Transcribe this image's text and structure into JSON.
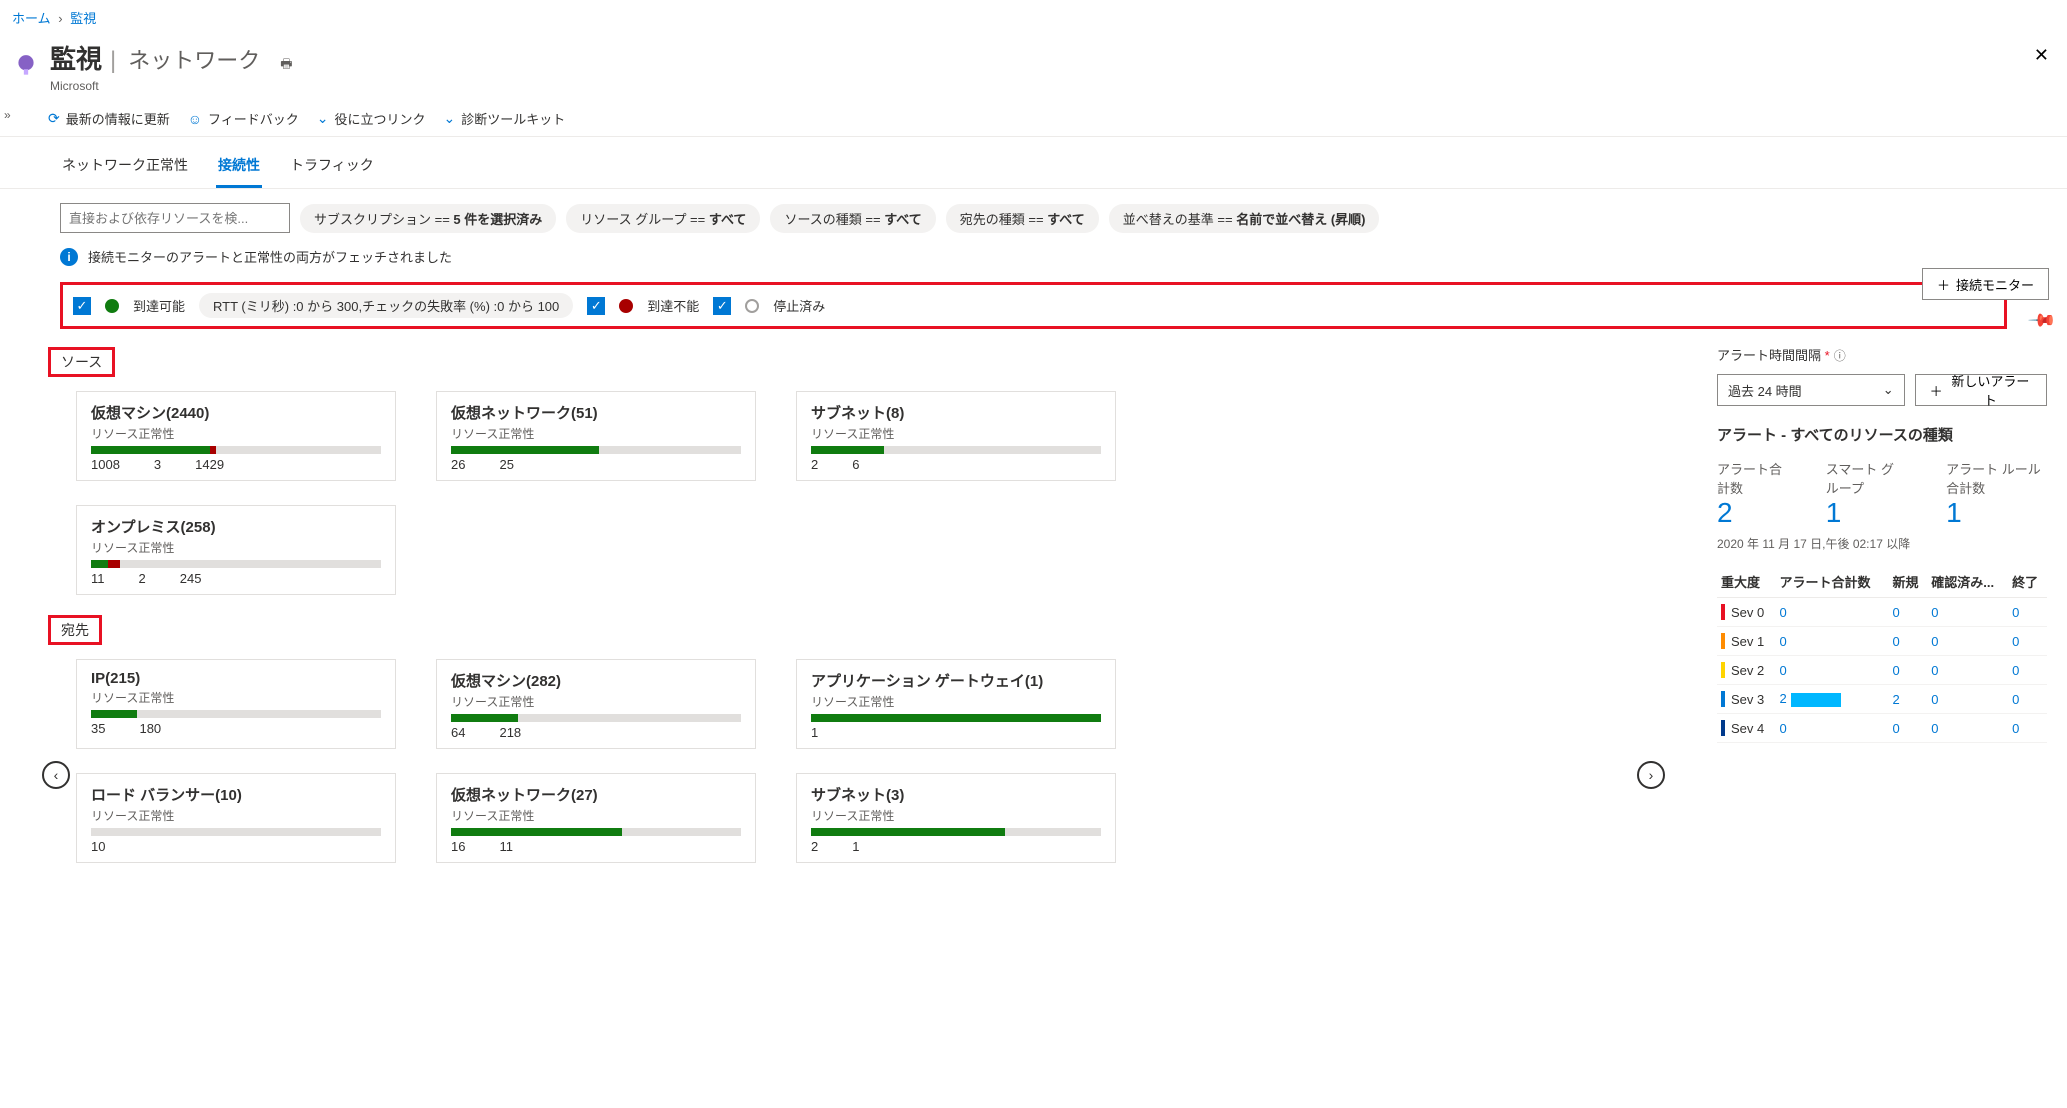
{
  "breadcrumb": {
    "home": "ホーム",
    "monitor": "監視"
  },
  "header": {
    "title": "監視",
    "subtitle": "ネットワーク",
    "ms": "Microsoft"
  },
  "toolbar": {
    "refresh": "最新の情報に更新",
    "feedback": "フィードバック",
    "links": "役に立つリンク",
    "diag": "診断ツールキット"
  },
  "tabs": {
    "health": "ネットワーク正常性",
    "conn": "接続性",
    "traffic": "トラフィック"
  },
  "search": {
    "placeholder": "直接および依存リソースを検..."
  },
  "pills": {
    "sub": {
      "prefix": "サブスクリプション == ",
      "val": "5 件を選択済み"
    },
    "rg": {
      "prefix": "リソース グループ == ",
      "val": "すべて"
    },
    "src": {
      "prefix": "ソースの種類 == ",
      "val": "すべて"
    },
    "dst": {
      "prefix": "宛先の種類 == ",
      "val": "すべて"
    },
    "sort": {
      "prefix": "並べ替えの基準 == ",
      "val": "名前で並べ替え (昇順)"
    }
  },
  "info": "接続モニターのアラートと正常性の両方がフェッチされました",
  "status": {
    "reachable": "到達可能",
    "rtt": "RTT (ミリ秒) :0 から 300,チェックの失敗率 (%) :0 から 100",
    "unreachable": "到達不能",
    "paused": "停止済み"
  },
  "addMonitor": "接続モニター",
  "sections": {
    "source": "ソース",
    "dest": "宛先"
  },
  "cardSub": "リソース正常性",
  "src_cards": [
    {
      "title": "仮想マシン(2440)",
      "g": 41,
      "r": 2,
      "vals": [
        "1008",
        "3",
        "1429"
      ]
    },
    {
      "title": "仮想ネットワーク(51)",
      "g": 51,
      "r": 0,
      "vals": [
        "26",
        "25"
      ]
    },
    {
      "title": "サブネット(8)",
      "g": 25,
      "r": 0,
      "vals": [
        "2",
        "6"
      ]
    },
    {
      "title": "オンプレミス(258)",
      "g": 6,
      "r": 4,
      "vals": [
        "11",
        "2",
        "245"
      ]
    }
  ],
  "dst_cards": [
    {
      "title": "IP(215)",
      "g": 16,
      "r": 0,
      "vals": [
        "35",
        "180"
      ]
    },
    {
      "title": "仮想マシン(282)",
      "g": 23,
      "r": 0,
      "vals": [
        "64",
        "218"
      ]
    },
    {
      "title": "アプリケーション ゲートウェイ(1)",
      "g": 100,
      "r": 0,
      "vals": [
        "1"
      ]
    },
    {
      "title": "ロード バランサー(10)",
      "g": 0,
      "r": 0,
      "vals": [
        "10"
      ]
    },
    {
      "title": "仮想ネットワーク(27)",
      "g": 59,
      "r": 0,
      "vals": [
        "16",
        "11"
      ]
    },
    {
      "title": "サブネット(3)",
      "g": 67,
      "r": 0,
      "vals": [
        "2",
        "1"
      ]
    }
  ],
  "alert": {
    "intervalLabel": "アラート時間間隔",
    "intervalValue": "過去 24 時間",
    "newBtn": "新しいアラート",
    "title": "アラート - すべてのリソースの種類",
    "kTotal": "アラート合計数",
    "vTotal": "2",
    "kSmart": "スマート グループ",
    "vSmart": "1",
    "kRules": "アラート ルール合計数",
    "vRules": "1",
    "ts": "2020 年 11 月 17 日,午後 02:17 以降",
    "cols": {
      "sev": "重大度",
      "total": "アラート合計数",
      "new": "新規",
      "ack": "確認済み...",
      "closed": "終了"
    },
    "rows": [
      {
        "sev": "Sev 0",
        "cls": "sb0",
        "t": "0",
        "n": "0",
        "a": "0",
        "c": "0",
        "bar": 0
      },
      {
        "sev": "Sev 1",
        "cls": "sb1",
        "t": "0",
        "n": "0",
        "a": "0",
        "c": "0",
        "bar": 0
      },
      {
        "sev": "Sev 2",
        "cls": "sb2",
        "t": "0",
        "n": "0",
        "a": "0",
        "c": "0",
        "bar": 0
      },
      {
        "sev": "Sev 3",
        "cls": "sb3",
        "t": "2",
        "n": "2",
        "a": "0",
        "c": "0",
        "bar": 50
      },
      {
        "sev": "Sev 4",
        "cls": "sb4",
        "t": "0",
        "n": "0",
        "a": "0",
        "c": "0",
        "bar": 0
      }
    ]
  }
}
